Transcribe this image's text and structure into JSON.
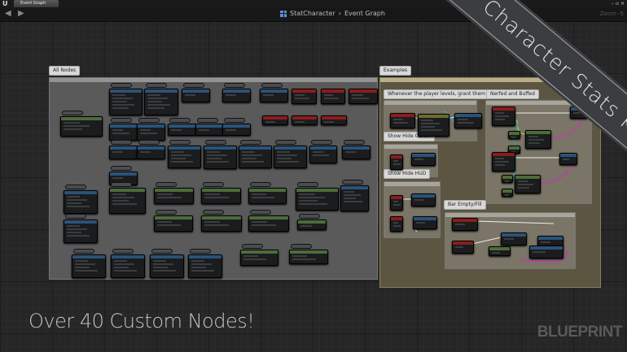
{
  "window": {
    "tab_title": "Event Graph",
    "logo": "U",
    "window_buttons": "– ▫ ×"
  },
  "toolbar": {
    "back_icon": "arrow-left-icon",
    "forward_icon": "arrow-right-icon",
    "breadcrumb_root": "StatCharacter",
    "breadcrumb_sep": "›",
    "breadcrumb_current": "Event Graph",
    "zoom": "Zoom -5"
  },
  "comments": {
    "all_nodes": "All Nodes",
    "examples": "Examples",
    "level_point": "Whenever the player levels, grant them a point.",
    "nerfed_buffed": "Nerfed and Buffed",
    "show_hide_cursor": "Show Hide Cursor",
    "show_hide_hud": "Show Hide HUD",
    "bar_empty_fill": "Bar Empty/Fill"
  },
  "banner": "Character Stats Kit",
  "tagline": "Over 40 Custom Nodes!",
  "watermark": "BLUEPRINT",
  "colors": {
    "function": "#2b5278",
    "event": "#8c1c1c",
    "pure": "#4d6b3a",
    "macro": "#6e6c28",
    "examples_bg": "#5c5542",
    "all_nodes_bg": "#595959"
  }
}
